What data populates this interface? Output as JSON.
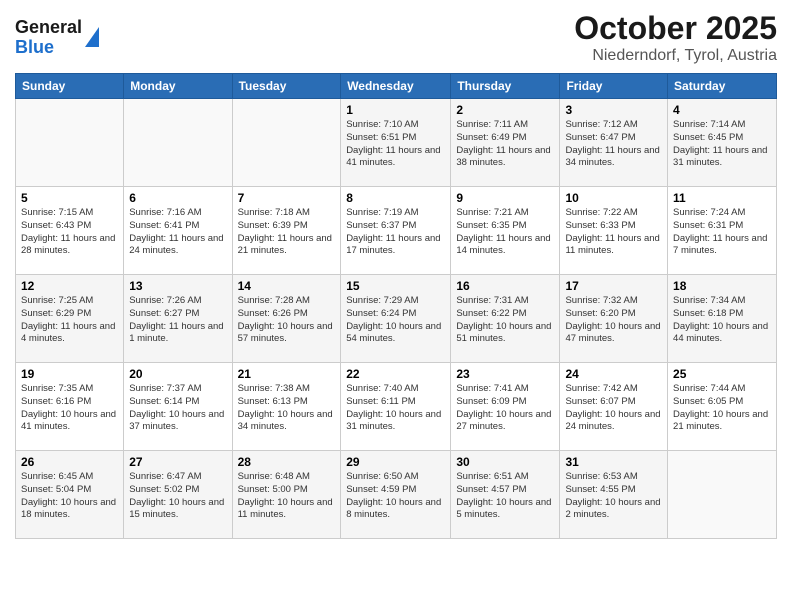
{
  "header": {
    "logo_line1": "General",
    "logo_line2": "Blue",
    "title": "October 2025",
    "subtitle": "Niederndorf, Tyrol, Austria"
  },
  "weekdays": [
    "Sunday",
    "Monday",
    "Tuesday",
    "Wednesday",
    "Thursday",
    "Friday",
    "Saturday"
  ],
  "weeks": [
    [
      {
        "day": "",
        "info": ""
      },
      {
        "day": "",
        "info": ""
      },
      {
        "day": "",
        "info": ""
      },
      {
        "day": "1",
        "info": "Sunrise: 7:10 AM\nSunset: 6:51 PM\nDaylight: 11 hours and 41 minutes."
      },
      {
        "day": "2",
        "info": "Sunrise: 7:11 AM\nSunset: 6:49 PM\nDaylight: 11 hours and 38 minutes."
      },
      {
        "day": "3",
        "info": "Sunrise: 7:12 AM\nSunset: 6:47 PM\nDaylight: 11 hours and 34 minutes."
      },
      {
        "day": "4",
        "info": "Sunrise: 7:14 AM\nSunset: 6:45 PM\nDaylight: 11 hours and 31 minutes."
      }
    ],
    [
      {
        "day": "5",
        "info": "Sunrise: 7:15 AM\nSunset: 6:43 PM\nDaylight: 11 hours and 28 minutes."
      },
      {
        "day": "6",
        "info": "Sunrise: 7:16 AM\nSunset: 6:41 PM\nDaylight: 11 hours and 24 minutes."
      },
      {
        "day": "7",
        "info": "Sunrise: 7:18 AM\nSunset: 6:39 PM\nDaylight: 11 hours and 21 minutes."
      },
      {
        "day": "8",
        "info": "Sunrise: 7:19 AM\nSunset: 6:37 PM\nDaylight: 11 hours and 17 minutes."
      },
      {
        "day": "9",
        "info": "Sunrise: 7:21 AM\nSunset: 6:35 PM\nDaylight: 11 hours and 14 minutes."
      },
      {
        "day": "10",
        "info": "Sunrise: 7:22 AM\nSunset: 6:33 PM\nDaylight: 11 hours and 11 minutes."
      },
      {
        "day": "11",
        "info": "Sunrise: 7:24 AM\nSunset: 6:31 PM\nDaylight: 11 hours and 7 minutes."
      }
    ],
    [
      {
        "day": "12",
        "info": "Sunrise: 7:25 AM\nSunset: 6:29 PM\nDaylight: 11 hours and 4 minutes."
      },
      {
        "day": "13",
        "info": "Sunrise: 7:26 AM\nSunset: 6:27 PM\nDaylight: 11 hours and 1 minute."
      },
      {
        "day": "14",
        "info": "Sunrise: 7:28 AM\nSunset: 6:26 PM\nDaylight: 10 hours and 57 minutes."
      },
      {
        "day": "15",
        "info": "Sunrise: 7:29 AM\nSunset: 6:24 PM\nDaylight: 10 hours and 54 minutes."
      },
      {
        "day": "16",
        "info": "Sunrise: 7:31 AM\nSunset: 6:22 PM\nDaylight: 10 hours and 51 minutes."
      },
      {
        "day": "17",
        "info": "Sunrise: 7:32 AM\nSunset: 6:20 PM\nDaylight: 10 hours and 47 minutes."
      },
      {
        "day": "18",
        "info": "Sunrise: 7:34 AM\nSunset: 6:18 PM\nDaylight: 10 hours and 44 minutes."
      }
    ],
    [
      {
        "day": "19",
        "info": "Sunrise: 7:35 AM\nSunset: 6:16 PM\nDaylight: 10 hours and 41 minutes."
      },
      {
        "day": "20",
        "info": "Sunrise: 7:37 AM\nSunset: 6:14 PM\nDaylight: 10 hours and 37 minutes."
      },
      {
        "day": "21",
        "info": "Sunrise: 7:38 AM\nSunset: 6:13 PM\nDaylight: 10 hours and 34 minutes."
      },
      {
        "day": "22",
        "info": "Sunrise: 7:40 AM\nSunset: 6:11 PM\nDaylight: 10 hours and 31 minutes."
      },
      {
        "day": "23",
        "info": "Sunrise: 7:41 AM\nSunset: 6:09 PM\nDaylight: 10 hours and 27 minutes."
      },
      {
        "day": "24",
        "info": "Sunrise: 7:42 AM\nSunset: 6:07 PM\nDaylight: 10 hours and 24 minutes."
      },
      {
        "day": "25",
        "info": "Sunrise: 7:44 AM\nSunset: 6:05 PM\nDaylight: 10 hours and 21 minutes."
      }
    ],
    [
      {
        "day": "26",
        "info": "Sunrise: 6:45 AM\nSunset: 5:04 PM\nDaylight: 10 hours and 18 minutes."
      },
      {
        "day": "27",
        "info": "Sunrise: 6:47 AM\nSunset: 5:02 PM\nDaylight: 10 hours and 15 minutes."
      },
      {
        "day": "28",
        "info": "Sunrise: 6:48 AM\nSunset: 5:00 PM\nDaylight: 10 hours and 11 minutes."
      },
      {
        "day": "29",
        "info": "Sunrise: 6:50 AM\nSunset: 4:59 PM\nDaylight: 10 hours and 8 minutes."
      },
      {
        "day": "30",
        "info": "Sunrise: 6:51 AM\nSunset: 4:57 PM\nDaylight: 10 hours and 5 minutes."
      },
      {
        "day": "31",
        "info": "Sunrise: 6:53 AM\nSunset: 4:55 PM\nDaylight: 10 hours and 2 minutes."
      },
      {
        "day": "",
        "info": ""
      }
    ]
  ]
}
